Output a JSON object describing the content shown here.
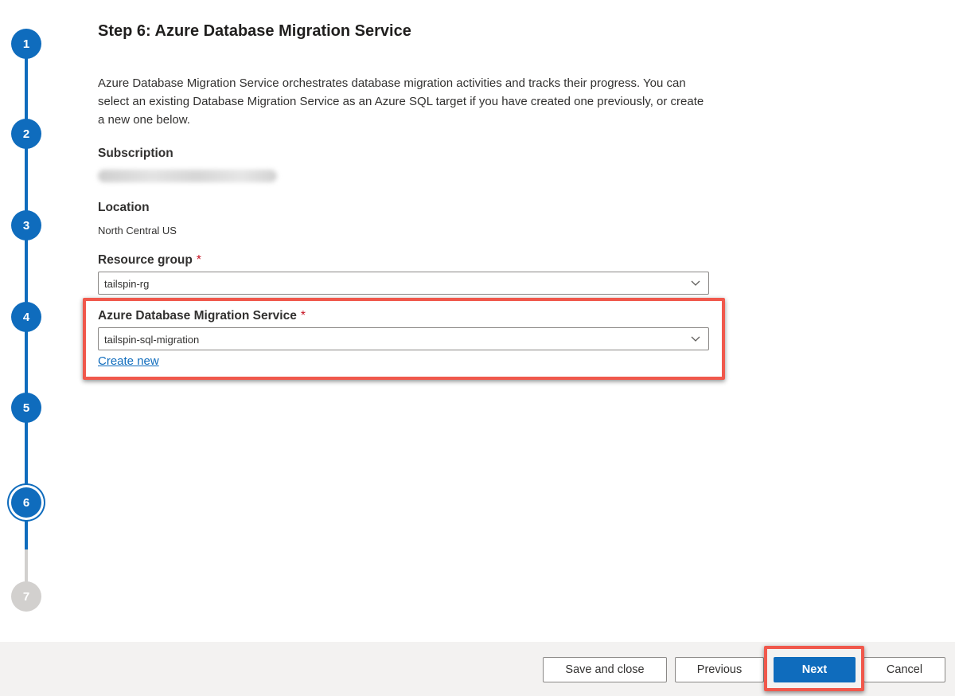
{
  "stepper": {
    "steps": [
      {
        "number": "1",
        "state": "done"
      },
      {
        "number": "2",
        "state": "done"
      },
      {
        "number": "3",
        "state": "done"
      },
      {
        "number": "4",
        "state": "done"
      },
      {
        "number": "5",
        "state": "done"
      },
      {
        "number": "6",
        "state": "current"
      },
      {
        "number": "7",
        "state": "pending"
      }
    ]
  },
  "page": {
    "title": "Step 6: Azure Database Migration Service",
    "description": "Azure Database Migration Service orchestrates database migration activities and tracks their progress. You can select an existing Database Migration Service as an Azure SQL target if you have created one previously, or create a new one below."
  },
  "fields": {
    "subscription": {
      "label": "Subscription"
    },
    "location": {
      "label": "Location",
      "value": "North Central US"
    },
    "resource_group": {
      "label": "Resource group",
      "required_mark": "*",
      "value": "tailspin-rg"
    },
    "dms": {
      "label": "Azure Database Migration Service",
      "required_mark": "*",
      "value": "tailspin-sql-migration"
    },
    "create_new_link": "Create new"
  },
  "footer": {
    "save_close": "Save and close",
    "previous": "Previous",
    "next": "Next",
    "cancel": "Cancel"
  },
  "colors": {
    "accent": "#0f6cbd",
    "highlight_border": "#f0584c",
    "required": "#c50f1f",
    "pending_step": "#d2d0ce"
  },
  "icons": {
    "dropdown": "chevron-down-icon"
  }
}
